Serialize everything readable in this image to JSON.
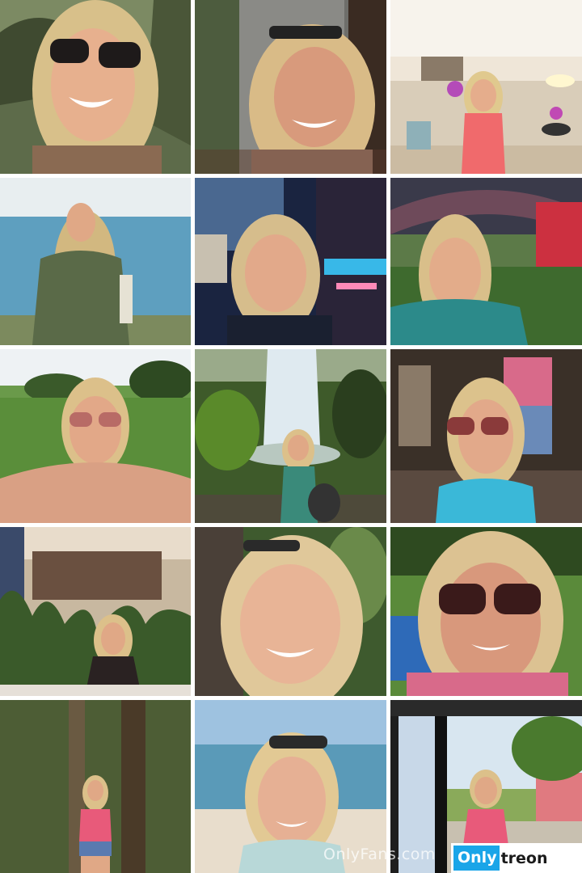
{
  "gallery": {
    "tiles": [
      {
        "scene": "selfie-sunglasses-trees"
      },
      {
        "scene": "selfie-stone-wall"
      },
      {
        "scene": "hotel-lobby-orchids"
      },
      {
        "scene": "lake-shore"
      },
      {
        "scene": "night-city-street"
      },
      {
        "scene": "garden-canopy"
      },
      {
        "scene": "park-bikini"
      },
      {
        "scene": "waterfall"
      },
      {
        "scene": "souvenir-shop"
      },
      {
        "scene": "restaurant-plants"
      },
      {
        "scene": "forest-closeup"
      },
      {
        "scene": "pool-big-sunglasses"
      },
      {
        "scene": "jungle-tree-paradise"
      },
      {
        "scene": "beach"
      },
      {
        "scene": "window-paradise"
      }
    ]
  },
  "watermark": {
    "site_text": "OnlyFans.com",
    "logo_part1": "Only",
    "logo_part2": "treon"
  }
}
